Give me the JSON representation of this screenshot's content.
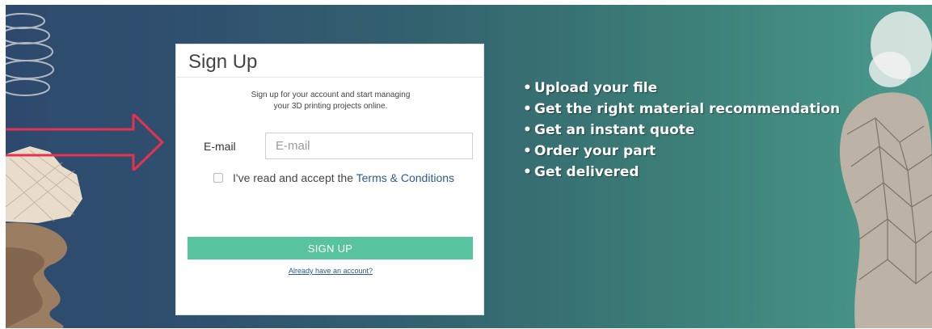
{
  "card": {
    "title": "Sign Up",
    "desc_line1": "Sign up for your account and start managing",
    "desc_line2": "your 3D printing projects online.",
    "email_label": "E-mail",
    "email_placeholder": "E-mail",
    "email_value": "",
    "terms_prefix": "I've read and accept the ",
    "terms_link": "Terms & Conditions",
    "terms_checked": false,
    "submit_label": "SIGN UP",
    "already_link": "Already have an account?"
  },
  "features": [
    "Upload your file",
    "Get the right material recommendation",
    "Get an instant quote",
    "Order your part",
    "Get delivered"
  ],
  "colors": {
    "button": "#57c39f",
    "arrow": "#e8304f",
    "link": "#2d5b8a"
  },
  "icons": {
    "arrow": "right-arrow-outline-icon",
    "checkbox": "checkbox-unchecked-icon"
  }
}
